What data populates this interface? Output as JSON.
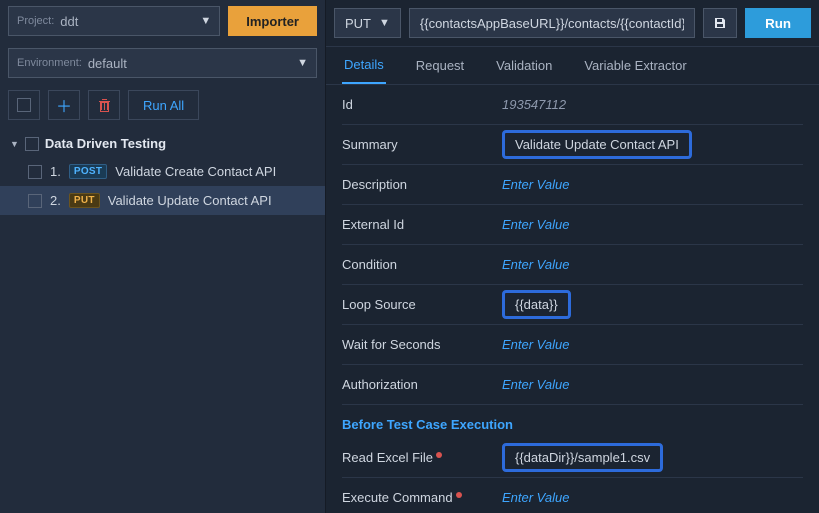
{
  "project": {
    "label": "Project:",
    "value": "ddt"
  },
  "environment": {
    "label": "Environment:",
    "value": "default"
  },
  "buttons": {
    "importer": "Importer",
    "runAll": "Run All",
    "run": "Run"
  },
  "tree": {
    "folder": "Data Driven Testing",
    "items": [
      {
        "idx": "1.",
        "method": "POST",
        "title": "Validate Create Contact API"
      },
      {
        "idx": "2.",
        "method": "PUT",
        "title": "Validate Update Contact API"
      }
    ]
  },
  "request": {
    "method": "PUT",
    "url": "{{contactsAppBaseURL}}/contacts/{{contactId}}"
  },
  "tabs": {
    "details": "Details",
    "request": "Request",
    "validation": "Validation",
    "extractor": "Variable Extractor"
  },
  "details": {
    "idLabel": "Id",
    "idValue": "193547112",
    "summaryLabel": "Summary",
    "summaryValue": "Validate Update Contact API",
    "descriptionLabel": "Description",
    "externalIdLabel": "External Id",
    "conditionLabel": "Condition",
    "loopLabel": "Loop Source",
    "loopValue": "{{data}}",
    "waitLabel": "Wait for Seconds",
    "authLabel": "Authorization",
    "placeholder": "Enter Value",
    "beforeSection": "Before Test Case Execution",
    "readExcelLabel": "Read Excel File",
    "readExcelValue": "{{dataDir}}/sample1.csv",
    "execCmdLabel": "Execute Command"
  }
}
